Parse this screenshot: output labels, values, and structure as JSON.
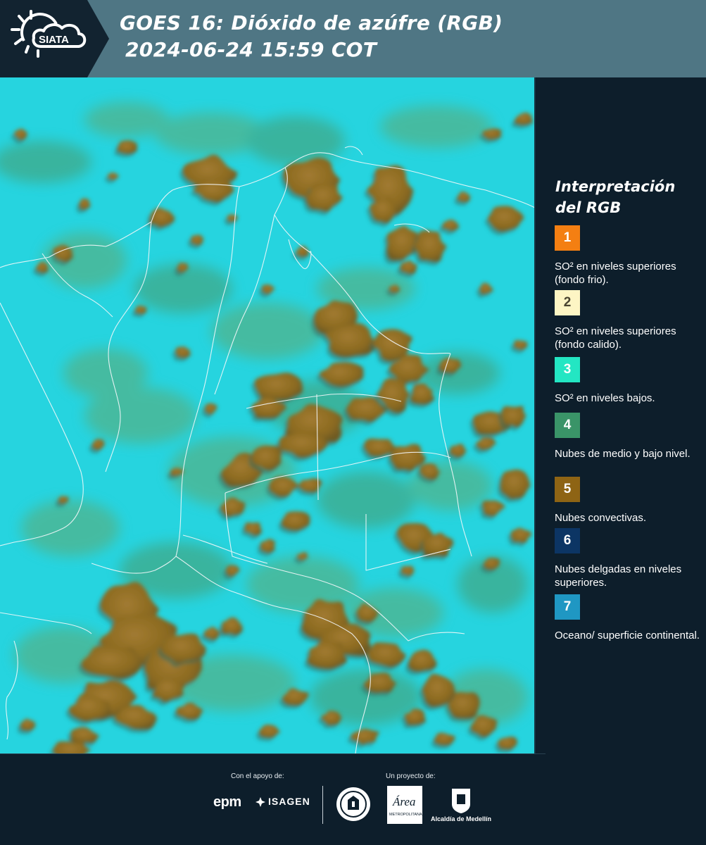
{
  "header": {
    "logo_text": "SIATA",
    "title_line1": "GOES 16: Dióxido de azúfre (RGB)",
    "title_line2": "2024-06-24 15:59 COT"
  },
  "colors": {
    "header_bg": "#4f7684",
    "panel_bg": "#0d1e2b",
    "map_background": "#26d4df",
    "convective_cloud": "#8b6a1f"
  },
  "legend": {
    "title": "Interpretación del RGB",
    "items": [
      {
        "number": "1",
        "label": "SO² en niveles superiores (fondo frio).",
        "color": "#f47f12"
      },
      {
        "number": "2",
        "label": "SO² en niveles superiores (fondo calido).",
        "color": "#fdf5c4"
      },
      {
        "number": "3",
        "label": "SO² en niveles bajos.",
        "color": "#23e6c3"
      },
      {
        "number": "4",
        "label": "Nubes de medio y bajo nivel.",
        "color": "#3a9468"
      },
      {
        "number": "5",
        "label": "Nubes convectivas.",
        "color": "#8e6414"
      },
      {
        "number": "6",
        "label": "Nubes delgadas en niveles superiores.",
        "color": "#0c3564"
      },
      {
        "number": "7",
        "label": "Oceano/ superficie continental.",
        "color": "#1f97c3"
      }
    ]
  },
  "footer": {
    "support_label": "Con el apoyo de:",
    "project_label": "Un proyecto de:",
    "sponsor_epm": "epm",
    "sponsor_isagen": "ISAGEN",
    "area_logo_text": "Área",
    "area_subtext": "METROPOLITANA",
    "alcaldia_text": "Alcaldía de Medellín"
  }
}
